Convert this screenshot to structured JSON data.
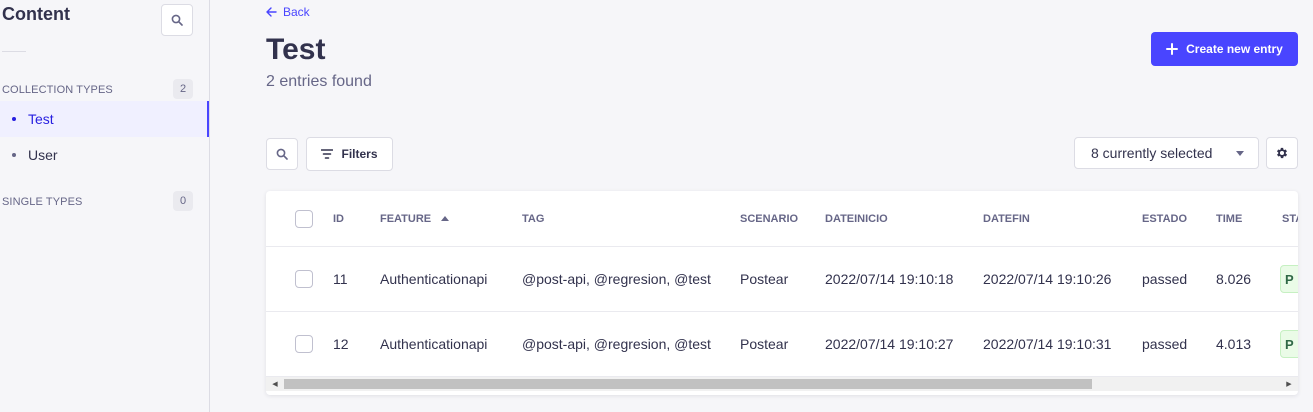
{
  "sidebar": {
    "title": "Content",
    "collection_types": {
      "label": "COLLECTION TYPES",
      "count": "2",
      "items": [
        {
          "label": "Test"
        },
        {
          "label": "User"
        }
      ]
    },
    "single_types": {
      "label": "SINGLE TYPES",
      "count": "0"
    }
  },
  "header": {
    "back_label": "Back",
    "title": "Test",
    "subtitle": "2 entries found",
    "create_label": "Create new entry"
  },
  "toolbar": {
    "filters_label": "Filters",
    "columns_select_value": "8 currently selected"
  },
  "table": {
    "columns": [
      "ID",
      "FEATURE",
      "TAG",
      "SCENARIO",
      "DATEINICIO",
      "DATEFIN",
      "ESTADO",
      "TIME",
      "STA"
    ],
    "sorted_column": "FEATURE",
    "rows": [
      {
        "id": "11",
        "feature": "Authenticationapi",
        "tag": "@post-api, @regresion, @test",
        "scenario": "Postear",
        "dateinicio": "2022/07/14 19:10:18",
        "datefin": "2022/07/14 19:10:26",
        "estado": "passed",
        "time": "8.026",
        "status": "P"
      },
      {
        "id": "12",
        "feature": "Authenticationapi",
        "tag": "@post-api, @regresion, @test",
        "scenario": "Postear",
        "dateinicio": "2022/07/14 19:10:27",
        "datefin": "2022/07/14 19:10:31",
        "estado": "passed",
        "time": "4.013",
        "status": "P"
      }
    ]
  },
  "colors": {
    "primary": "#4945ff",
    "sidebar_active_bg": "#f0f0ff",
    "status_badge_bg": "#eafbe7"
  }
}
